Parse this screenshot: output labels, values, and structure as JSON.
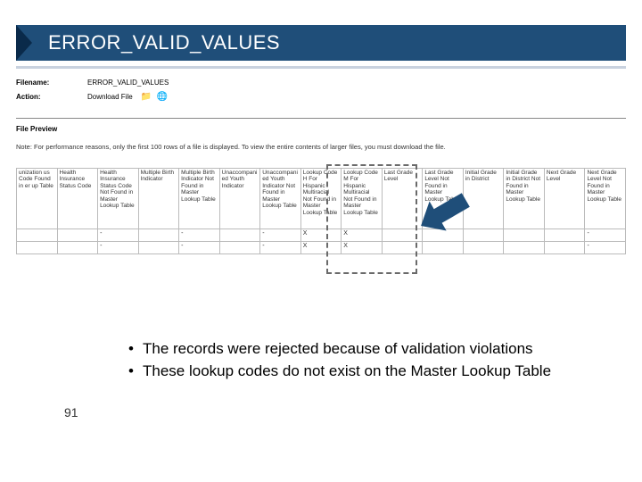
{
  "title": "ERROR_VALID_VALUES",
  "filename_label": "Filename:",
  "filename_value": "ERROR_VALID_VALUES",
  "action_label": "Action:",
  "action_value": "Download File",
  "icons": {
    "folder": "📁",
    "globe": "🌐"
  },
  "file_preview_label": "File Preview",
  "note": "Note: For performance reasons, only the first 100 rows of a file is displayed. To view the entire contents of larger files, you must download the file.",
  "columns": [
    "unization us Code Found in er up Table",
    "Health Insurance Status Code",
    "Health Insurance Status Code Not Found in Master Lookup Table",
    "Multiple Birth Indicator",
    "Multiple Birth Indicator Not Found in Master Lookup Table",
    "Unaccompanied Youth Indicator",
    "Unaccompanied Youth Indicator Not Found in Master Lookup Table",
    "Lookup Code H For Hispanic Multiracial Not Found in Master Lookup Table",
    "Lookup Code M For Hispanic Multiracial Not Found in Master Lookup Table",
    "Last Grade Level",
    "Last Grade Level Not Found in Master Lookup Table",
    "Initial Grade in District",
    "Initial Grade in District Not Found in Master Lookup Table",
    "Next Grade Level",
    "Next Grade Level Not Found in Master Lookup Table"
  ],
  "rows": [
    [
      "",
      "",
      "-",
      "",
      "-",
      "",
      "-",
      "X",
      "X",
      "",
      "",
      "",
      "",
      "",
      "-"
    ],
    [
      "",
      "",
      "-",
      "",
      "-",
      "",
      "-",
      "X",
      "X",
      "",
      "",
      "",
      "",
      "",
      "-"
    ]
  ],
  "bullets": [
    "The records were rejected because of validation violations",
    "These lookup codes do not exist on the Master Lookup Table"
  ],
  "page_number": "91"
}
